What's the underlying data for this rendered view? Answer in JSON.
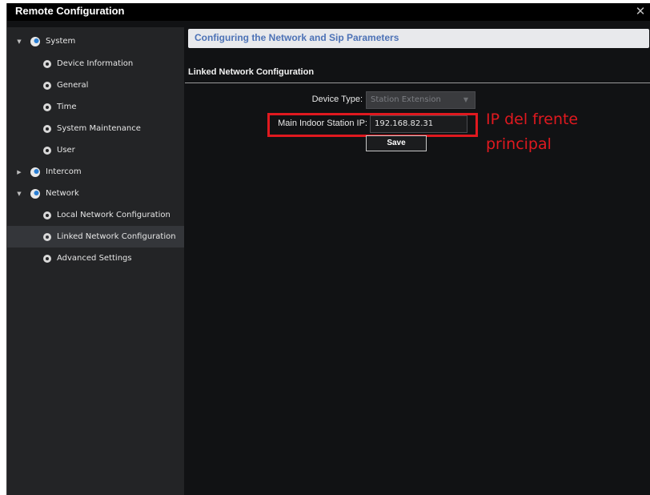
{
  "window": {
    "title": "Remote Configuration",
    "close_glyph": "✕"
  },
  "sidebar": {
    "items": [
      {
        "label": "System",
        "level": 0,
        "expanded": true,
        "icon": "node-icon"
      },
      {
        "label": "Device Information",
        "level": 1,
        "icon": "gear-icon"
      },
      {
        "label": "General",
        "level": 1,
        "icon": "gear-icon"
      },
      {
        "label": "Time",
        "level": 1,
        "icon": "gear-icon"
      },
      {
        "label": "System Maintenance",
        "level": 1,
        "icon": "gear-icon"
      },
      {
        "label": "User",
        "level": 1,
        "icon": "gear-icon"
      },
      {
        "label": "Intercom",
        "level": 0,
        "expanded": false,
        "icon": "node-icon"
      },
      {
        "label": "Network",
        "level": 0,
        "expanded": true,
        "icon": "node-icon"
      },
      {
        "label": "Local Network Configuration",
        "level": 1,
        "icon": "gear-icon"
      },
      {
        "label": "Linked Network Configuration",
        "level": 1,
        "icon": "gear-icon",
        "selected": true
      },
      {
        "label": "Advanced Settings",
        "level": 1,
        "icon": "gear-icon"
      }
    ]
  },
  "main": {
    "header": "Configuring the Network and Sip Parameters",
    "section_title": "Linked Network Configuration",
    "device_type": {
      "label": "Device Type:",
      "value": "Station Extension"
    },
    "main_indoor_ip": {
      "label": "Main Indoor Station IP:",
      "value": "192.168.82.31"
    },
    "save_label": "Save",
    "annotation": {
      "line1": "IP del frente",
      "line2": "principal",
      "color": "#e0191f"
    }
  },
  "colors": {
    "sidebar_bg": "#232426",
    "main_bg": "#111214",
    "header_text": "#4d72b6",
    "selected_bg": "#34363a"
  }
}
